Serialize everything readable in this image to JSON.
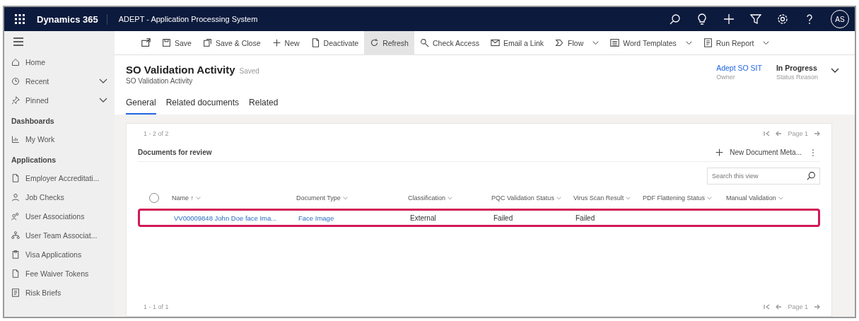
{
  "top_bar": {
    "app_name": "Dynamics 365",
    "title": "ADEPT - Application Processing System",
    "avatar": "AS"
  },
  "command_bar": [
    {
      "kind": "icon"
    },
    {
      "kind": "button",
      "label": "Save",
      "selected": false
    },
    {
      "kind": "button",
      "label": "Save & Close",
      "selected": false
    },
    {
      "kind": "button",
      "label": "New",
      "selected": false
    },
    {
      "kind": "button",
      "label": "Deactivate",
      "selected": false
    },
    {
      "kind": "button",
      "label": "Refresh",
      "selected": true
    },
    {
      "kind": "button",
      "label": "Check Access",
      "selected": false
    },
    {
      "kind": "button",
      "label": "Email a Link",
      "selected": false
    },
    {
      "kind": "split",
      "label": "Flow",
      "selected": false
    },
    {
      "kind": "split",
      "label": "Word Templates",
      "selected": false
    },
    {
      "kind": "split",
      "label": "Run Report",
      "selected": false
    }
  ],
  "sidebar": {
    "items": [
      {
        "kind": "item",
        "label": "Home"
      },
      {
        "kind": "expander",
        "label": "Recent",
        "expanded": false
      },
      {
        "kind": "expander",
        "label": "Pinned",
        "expanded": false
      },
      {
        "kind": "header",
        "label": "Dashboards"
      },
      {
        "kind": "item",
        "label": "My Work"
      },
      {
        "kind": "header",
        "label": "Applications"
      },
      {
        "kind": "item",
        "label": "Employer Accreditati..."
      },
      {
        "kind": "item",
        "label": "Job Checks"
      },
      {
        "kind": "item",
        "label": "User Associations"
      },
      {
        "kind": "item",
        "label": "User Team Associat..."
      },
      {
        "kind": "item",
        "label": "Visa Applications"
      },
      {
        "kind": "item",
        "label": "Fee Waiver Tokens"
      },
      {
        "kind": "item",
        "label": "Risk Briefs"
      }
    ]
  },
  "record": {
    "title": "SO Validation Activity",
    "save_state": "Saved",
    "entity": "SO Validation Activity",
    "owner": {
      "value": "Adept SO SIT",
      "label": "Owner"
    },
    "status": {
      "value": "In Progress",
      "label": "Status Reason"
    }
  },
  "tabs": [
    {
      "label": "General",
      "selected": true
    },
    {
      "label": "Related documents",
      "selected": false
    },
    {
      "label": "Related",
      "selected": false
    }
  ],
  "upper_grid": {
    "record_count": "1 - 2 of 2",
    "page": "Page 1"
  },
  "documents": {
    "title": "Documents for review",
    "all_selected": false,
    "new_button": "New Document Meta...",
    "search": {
      "placeholder": "Search this view"
    },
    "columns": [
      "Name ↑",
      "Document Type",
      "Classification",
      "PQC Validation Status",
      "Virus Scan Result",
      "PDF Flattening Status",
      "Manual Validation"
    ],
    "rows": [
      {
        "highlighted": true,
        "cells": [
          "VV00009848 John Doe face Ima...",
          "Face Image",
          "External",
          "Failed",
          "Failed",
          "",
          ""
        ]
      }
    ],
    "record_count": "1 - 1 of 1",
    "page": "Page 1"
  }
}
